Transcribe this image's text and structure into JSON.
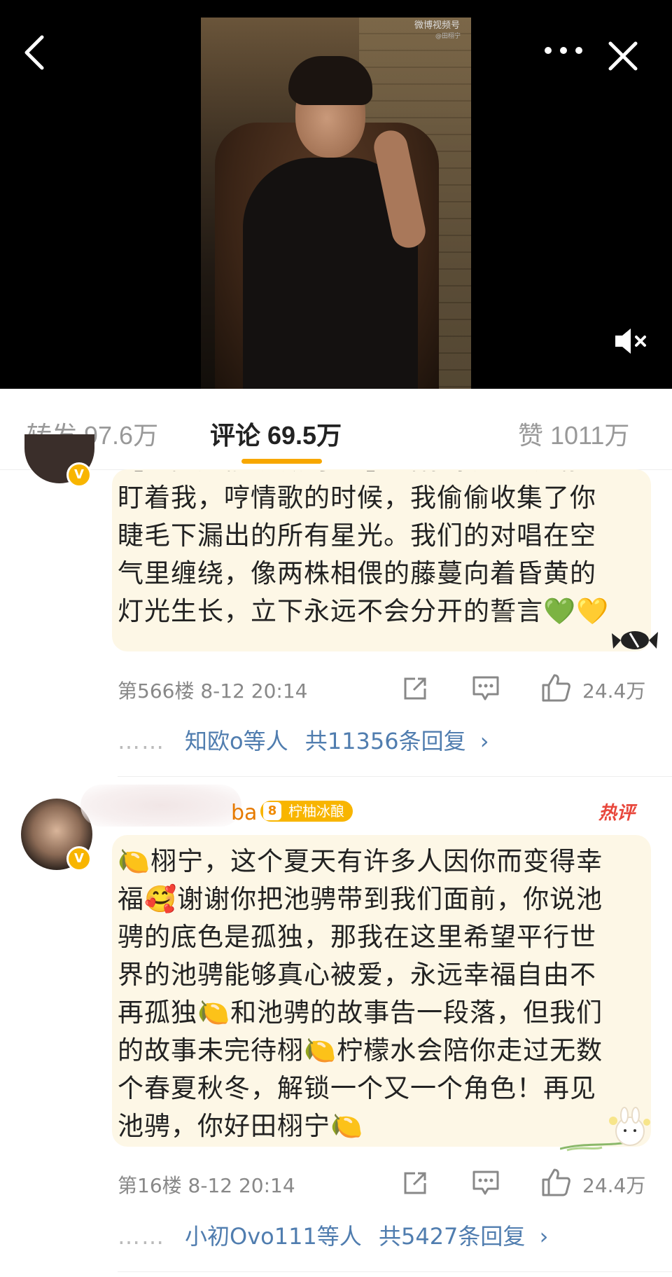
{
  "header": {
    "watermark": "微博视频号",
    "watermark_sub": "@田栩宁"
  },
  "tabs": [
    {
      "label": "转发 97.6万"
    },
    {
      "label": "评论 69.5万"
    },
    {
      "label": "赞 1011万"
    }
  ],
  "comments": [
    {
      "text_lines": [
        "【一曲定情 天城小爱】当你漂亮的眼睛",
        "盯着我，哼情歌的时候，我偷偷收集了你",
        "睫毛下漏出的所有星光。我们的对唱在空",
        "气里缠绕，像两株相偎的藤蔓向着昏黄的",
        "灯光生长，立下永远不会分开的誓言💚💛"
      ],
      "meta": "第566楼 8-12 20:14",
      "likes": "24.4万",
      "replies_by": "知欧o等人",
      "replies_total": "共11356条回复",
      "dots": "……"
    },
    {
      "nickname_tail": "ba",
      "badge_level": "8",
      "badge_label": "柠柚冰酿",
      "hot_label": "热评",
      "text_lines": [
        "🍋栩宁，这个夏天有许多人因你而变得幸",
        "福🥰谢谢你把池骋带到我们面前，你说池",
        "骋的底色是孤独，那我在这里希望平行世",
        "界的池骋能够真心被爱，永远幸福自由不",
        "再孤独🍋和池骋的故事告一段落，但我们",
        "的故事未完待栩🍋柠檬水会陪你走过无数",
        "个春夏秋冬，解锁一个又一个角色！再见",
        "池骋，你好田栩宁🍋"
      ],
      "meta": "第16楼 8-12 20:14",
      "likes": "24.4万",
      "replies_by": "小初Ovo111等人",
      "replies_total": "共5427条回复",
      "dots": "……"
    }
  ],
  "colors": {
    "accent": "#f7a700",
    "link": "#507daf",
    "bubble": "#fdf7e6",
    "hot": "#e8473c"
  }
}
